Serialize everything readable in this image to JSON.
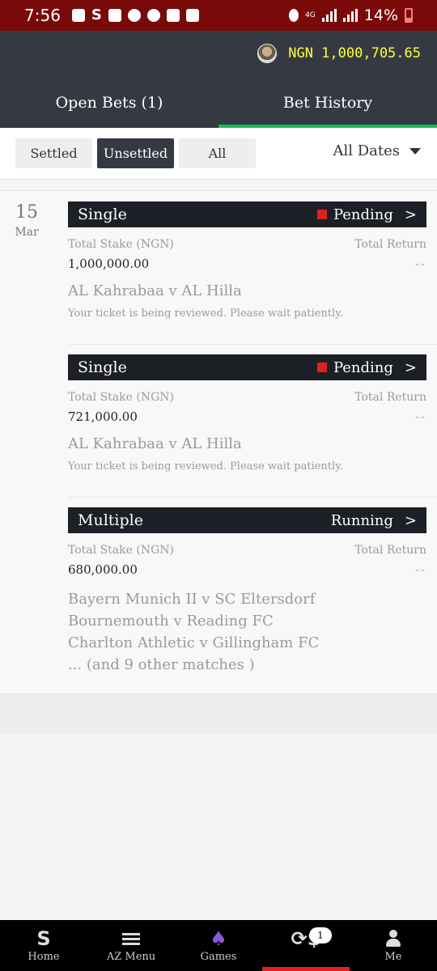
{
  "status_bar": {
    "time": "7:56",
    "network": "4G",
    "battery": "14%"
  },
  "header": {
    "balance": "NGN 1,000,705.65",
    "tabs": [
      {
        "label": "Open Bets (1)",
        "active": false
      },
      {
        "label": "Bet History",
        "active": true
      }
    ],
    "accent": "#1db954"
  },
  "filters": {
    "buttons": [
      "Settled",
      "Unsettled",
      "All"
    ],
    "active": "Unsettled",
    "dates_label": "All Dates"
  },
  "date_group": {
    "day": "15",
    "month": "Mar"
  },
  "tickets": [
    {
      "type": "Single",
      "status": "Pending",
      "status_marker": true,
      "stake_label": "Total Stake (NGN)",
      "return_label": "Total Return",
      "stake": "1,000,000.00",
      "return": "--",
      "match": "AL Kahrabaa v AL Hilla",
      "note": "Your ticket is being reviewed. Please wait patiently."
    },
    {
      "type": "Single",
      "status": "Pending",
      "status_marker": true,
      "stake_label": "Total Stake (NGN)",
      "return_label": "Total Return",
      "stake": "721,000.00",
      "return": "--",
      "match": "AL Kahrabaa v AL Hilla",
      "note": "Your ticket is being reviewed. Please wait patiently."
    },
    {
      "type": "Multiple",
      "status": "Running",
      "status_marker": false,
      "stake_label": "Total Stake (NGN)",
      "return_label": "Total Return",
      "stake": "680,000.00",
      "return": "--",
      "matches": [
        "Bayern Munich II v SC Eltersdorf",
        "Bournemouth v Reading FC",
        "Charlton Athletic v Gillingham FC",
        "... (and 9 other matches )"
      ]
    }
  ],
  "bottom_nav": {
    "items": [
      {
        "label": "Home",
        "icon": "home-s-icon"
      },
      {
        "label": "AZ Menu",
        "icon": "menu-icon"
      },
      {
        "label": "Games",
        "icon": "spade-icon"
      },
      {
        "label": "",
        "icon": "cashout-icon",
        "badge": "1",
        "active": true
      },
      {
        "label": "Me",
        "icon": "person-icon"
      }
    ],
    "active_color": "#e02020"
  },
  "colors": {
    "status_bar": "#7a0a0a",
    "header": "#353a42",
    "balance": "#ffff3a",
    "ticket_bar": "#1c1f25",
    "pending": "#e02020"
  }
}
